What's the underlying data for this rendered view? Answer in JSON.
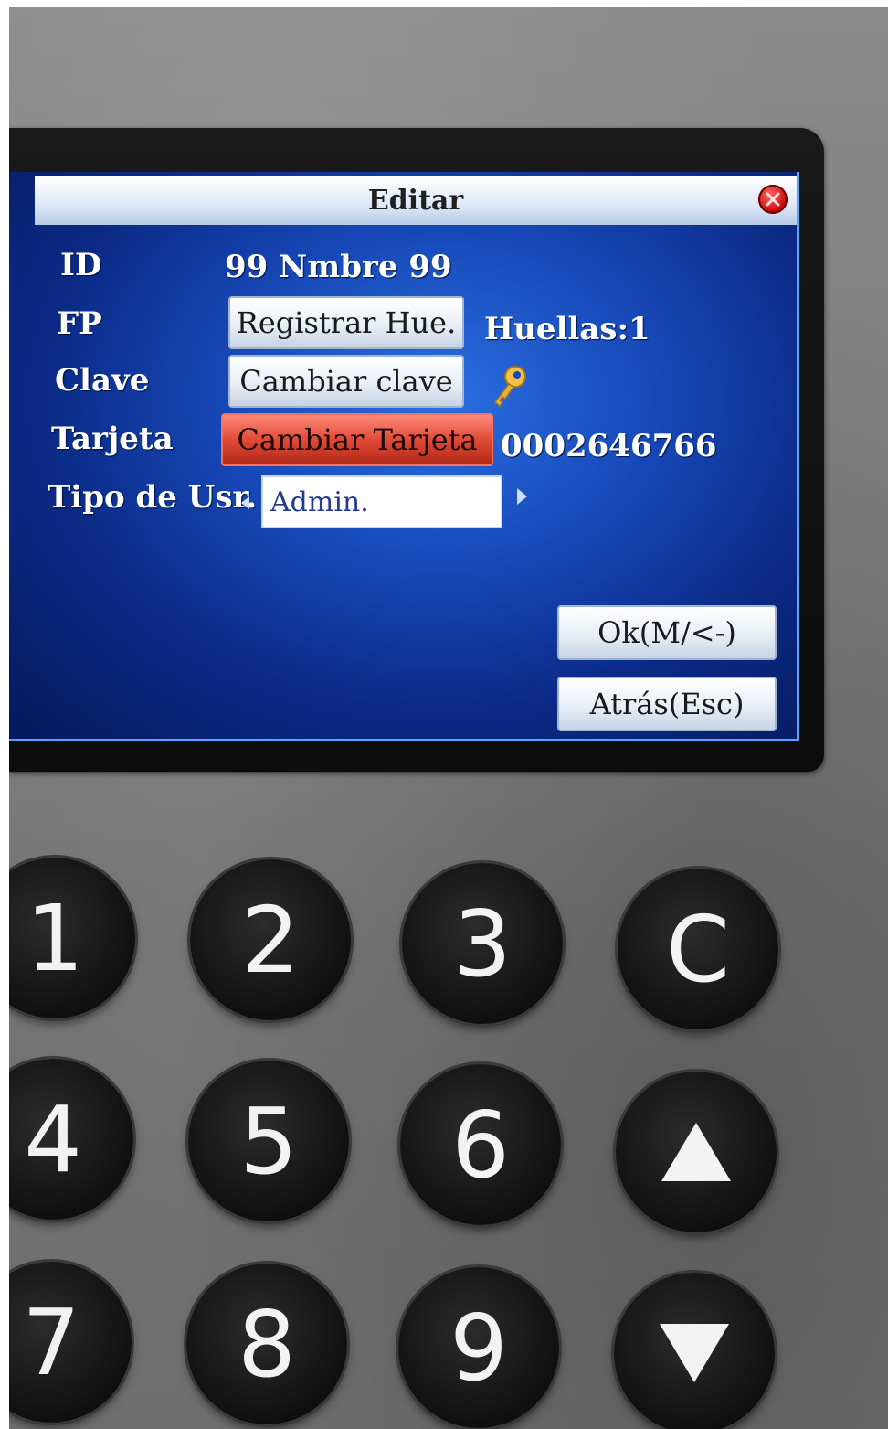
{
  "window": {
    "title": "Editar"
  },
  "form": {
    "id": {
      "label": "ID",
      "value": "99  Nmbre  99"
    },
    "fp": {
      "label": "FP",
      "button_label": "Registrar Hue.",
      "count_text": "Huellas:1"
    },
    "clave": {
      "label": "Clave",
      "button_label": "Cambiar clave",
      "icon": "key-icon"
    },
    "tarjeta": {
      "label": "Tarjeta",
      "button_label": "Cambiar Tarjeta",
      "value": "0002646766"
    },
    "tipo": {
      "label": "Tipo de Usr.",
      "selected": "Admin."
    }
  },
  "actions": {
    "ok_label": "Ok(M/<-)",
    "back_label": "Atrás(Esc)"
  },
  "keypad": {
    "row1": [
      "1",
      "2",
      "3",
      "C"
    ],
    "row2": [
      "4",
      "5",
      "6"
    ],
    "row3": [
      "7",
      "8",
      "9"
    ],
    "up_icon": "up-arrow-icon",
    "down_icon": "down-arrow-icon"
  },
  "colors": {
    "screen_blue": "#1748b8",
    "active_button": "#e04a36",
    "close_button": "#c40000"
  }
}
